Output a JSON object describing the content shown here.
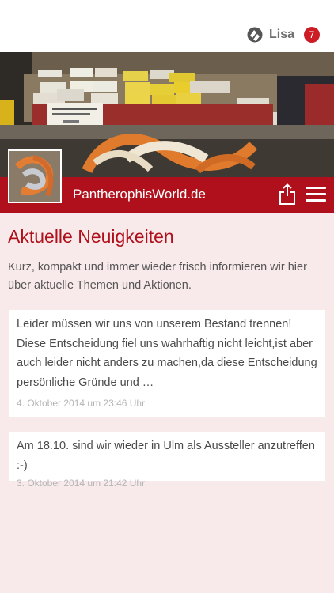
{
  "header": {
    "user_name": "Lisa",
    "badge_count": "7"
  },
  "site": {
    "name": "PantherophisWorld.de"
  },
  "main": {
    "heading": "Aktuelle Neuigkeiten",
    "intro": "Kurz, kompakt und immer wieder frisch informieren wir hier über aktuelle Themen und Aktionen.",
    "posts": [
      {
        "text": "Leider müssen wir uns von unserem Bestand trennen! Diese Entscheidung fiel uns wahrhaftig nicht leicht,ist aber auch leider nicht anders zu machen,da diese Entscheidung persönliche Gründe und …",
        "date": "4. Oktober 2014 um 23:46 Uhr"
      },
      {
        "text": "Am 18.10. sind wir wieder in Ulm als Aussteller anzutreffen :-)",
        "date": "3. Oktober 2014 um 21:42 Uhr"
      }
    ]
  },
  "colors": {
    "accent": "#b0101b",
    "badge": "#cc1d27",
    "background": "#f8e9ea"
  },
  "icons": [
    "app-logo-icon",
    "share-icon",
    "hamburger-menu-icon"
  ]
}
